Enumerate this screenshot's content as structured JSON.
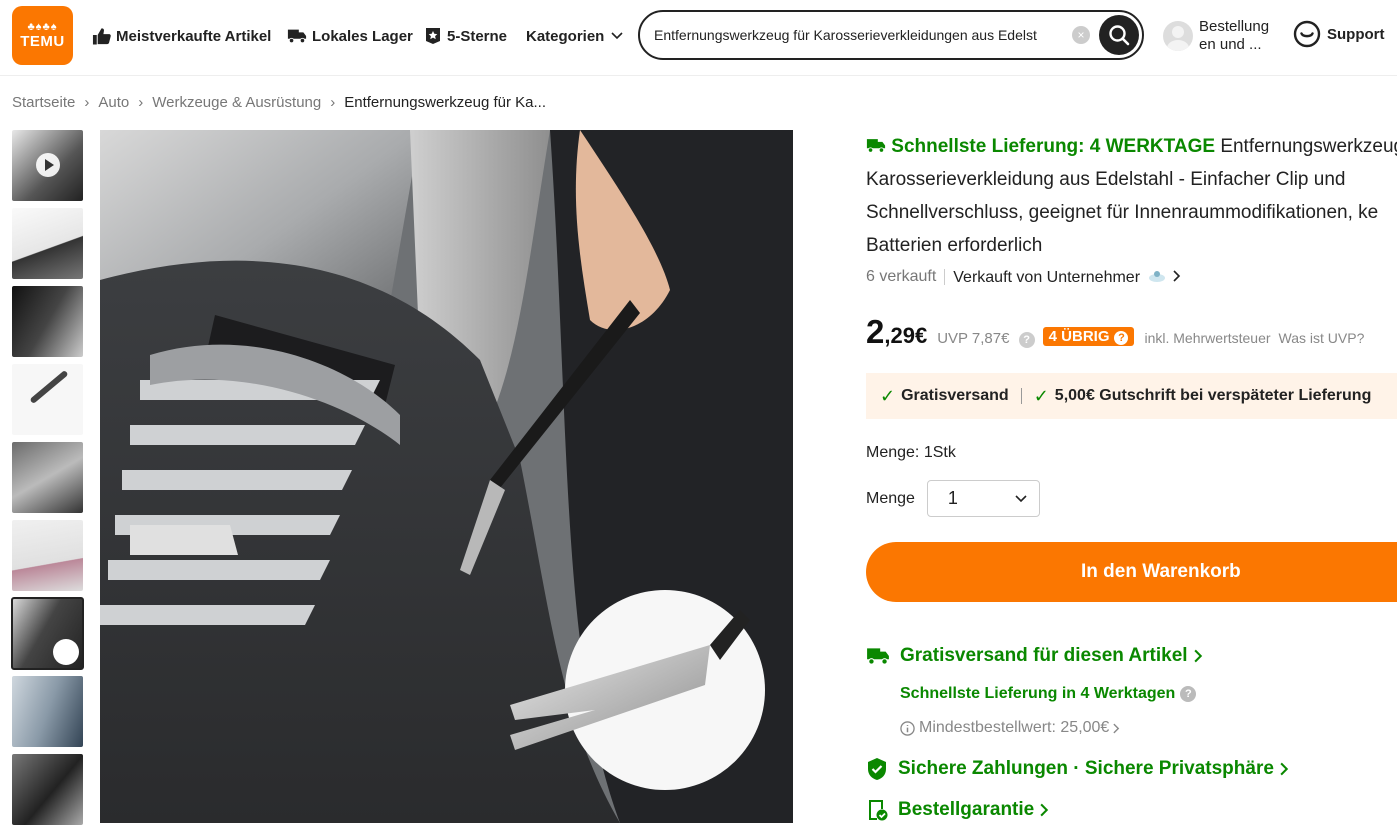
{
  "header": {
    "logo_icons": "♣♠♣♠",
    "logo_text": "TEMU",
    "nav": [
      {
        "label": "Meistverkaufte Artikel",
        "icon": "thumbs-up-icon"
      },
      {
        "label": "Lokales Lager",
        "icon": "truck-icon"
      },
      {
        "label": "5-Sterne",
        "icon": "star-badge-icon"
      },
      {
        "label": "Kategorien",
        "icon": "chevron-down-icon"
      }
    ],
    "search_value": "Entfernungswerkzeug für Karosserieverkleidungen aus Edelst",
    "account_line1": "Bestellung",
    "account_line2": "en und ...",
    "support_label": "Support"
  },
  "breadcrumb": {
    "items": [
      "Startseite",
      "Auto",
      "Werkzeuge & Ausrüstung"
    ],
    "current": "Entfernungswerkzeug für Ka...",
    "separator": "›"
  },
  "product": {
    "fast_delivery": "Schnellste Lieferung: 4 WERKTAGE",
    "title": "Entfernungswerkzeug Karosserieverkleidung aus Edelstahl - Einfacher Clip und Schnellverschluss, geeignet für Innenraummodifikationen, ke Batterien erforderlich",
    "sold": "6 verkauft",
    "seller": "Verkauft von Unternehmer",
    "price_main": "2",
    "price_cents": ",29€",
    "uvp": "UVP 7,87€",
    "remaining": "4 ÜBRIG",
    "vat": "inkl. Mehrwertsteuer",
    "uvp_question": "Was ist UVP?",
    "free_shipping": "Gratisversand",
    "late_credit": "5,00€ Gutschrift bei verspäteter Lieferung",
    "quantity_info": "Menge: 1Stk",
    "quantity_label": "Menge",
    "quantity_value": "1",
    "add_to_cart": "In den Warenkorb"
  },
  "benefits": {
    "shipping_title": "Gratisversand für diesen Artikel",
    "shipping_fast": "Schnellste Lieferung in 4 Werktagen",
    "min_order": "Mindestbestellwert: 25,00€",
    "payments": "Sichere Zahlungen · Sichere Privatsphäre",
    "guarantee": "Bestellgarantie"
  },
  "colors": {
    "brand": "#fb7701",
    "green": "#0a8800"
  }
}
